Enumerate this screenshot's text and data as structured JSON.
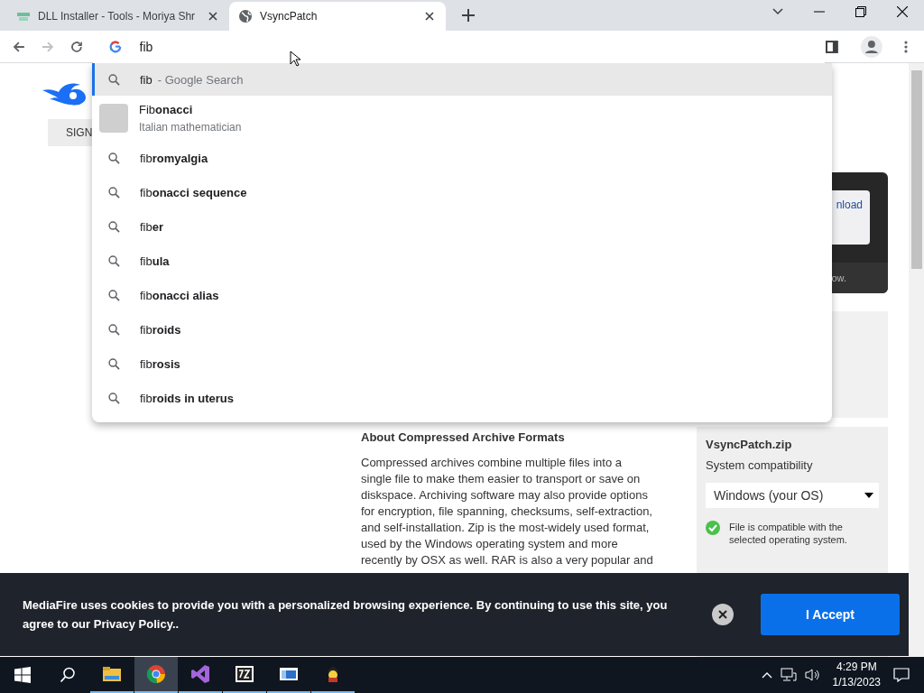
{
  "browser": {
    "tabs": [
      {
        "title": "DLL Installer - Tools - Moriya Shr",
        "selected": false
      },
      {
        "title": "VsyncPatch",
        "selected": true
      }
    ],
    "omnibox": {
      "value": "fib"
    },
    "suggestions": [
      {
        "kind": "search",
        "text": "fib",
        "suffix": "- Google Search",
        "selected": true
      },
      {
        "kind": "entity",
        "text": "Fib**onacci**",
        "subtitle": "Italian mathematician",
        "selected": false
      },
      {
        "kind": "search",
        "text": "fib**romyalgia**",
        "selected": false
      },
      {
        "kind": "search",
        "text": "fib**onacci sequence**",
        "selected": false
      },
      {
        "kind": "search",
        "text": "fib**er**",
        "selected": false
      },
      {
        "kind": "search",
        "text": "fib**ula**",
        "selected": false
      },
      {
        "kind": "search",
        "text": "fib**onacci alias**",
        "selected": false
      },
      {
        "kind": "search",
        "text": "fib**roids**",
        "selected": false
      },
      {
        "kind": "search",
        "text": "fib**rosis**",
        "selected": false
      },
      {
        "kind": "search",
        "text": "fib**roids in uterus**",
        "selected": false
      }
    ]
  },
  "page": {
    "sign_button": "SIGN",
    "download_box": {
      "button_text": "nload",
      "note": "ow."
    },
    "article": {
      "heading": "About Compressed Archive Formats",
      "body": "Compressed archives combine multiple files into a single file to make them easier to transport or save on diskspace. Archiving software may also provide options for encryption, file spanning, checksums, self-extraction, and self-installation. Zip is the most-widely used format, used by the Windows operating system and more recently by OSX as well. RAR is also a very popular and"
    },
    "file_panel": {
      "filename": "VsyncPatch.zip",
      "label": "System compatibility",
      "os_select": "Windows (your OS)",
      "compatible": true,
      "status": "File is compatible with the selected operating system."
    }
  },
  "cookie_banner": {
    "message": "MediaFire uses cookies to provide you with a personalized browsing experience. By continuing to use this site, you agree to our Privacy Policy..",
    "accept": "I Accept"
  },
  "taskbar": {
    "apps": [
      {
        "kind": "explorer",
        "selected": false
      },
      {
        "kind": "chrome",
        "selected": true
      },
      {
        "kind": "studio",
        "selected": false
      },
      {
        "kind": "sevenzip",
        "selected": false
      },
      {
        "kind": "window",
        "selected": false
      },
      {
        "kind": "game",
        "selected": false
      }
    ],
    "time": "4:29 PM",
    "date": "1/13/2023"
  }
}
